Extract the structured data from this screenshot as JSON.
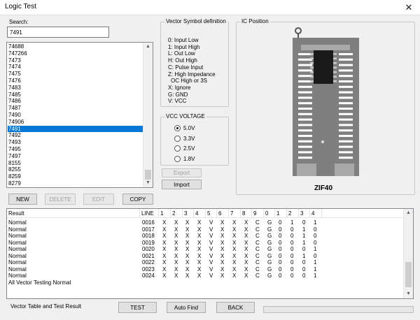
{
  "window": {
    "title": "Logic Test",
    "close_glyph": "✕"
  },
  "search": {
    "label": "Search:",
    "value": "7491"
  },
  "chip_list": {
    "items": [
      "74688",
      "747266",
      "7473",
      "7474",
      "7475",
      "7476",
      "7483",
      "7485",
      "7486",
      "7487",
      "7490",
      "74906",
      "7491",
      "7492",
      "7493",
      "7495",
      "7497",
      "8155",
      "8255",
      "8259",
      "8279"
    ],
    "selected": "7491"
  },
  "buttons": {
    "new": "NEW",
    "delete": "DELETE",
    "edit": "EDIT",
    "copy": "COPY",
    "export": "Export",
    "import": "Import",
    "test": "TEST",
    "auto_find": "Auto Find",
    "back": "BACK"
  },
  "vector_definition": {
    "title": "Vector Symbol definition",
    "lines": [
      "0: Input Low",
      "1: Input High",
      "L: Out Low",
      "H: Out High",
      "C: Pulse Input",
      "Z: High Impedance",
      "OC High or 3S",
      "X: Ignore",
      "G: GND",
      "V: VCC"
    ]
  },
  "vcc_voltage": {
    "title": "VCC VOLTAGE",
    "options": [
      "5.0V",
      "3.3V",
      "2.5V",
      "1.8V"
    ],
    "selected": "5.0V"
  },
  "ic_position": {
    "title": "IC Position",
    "socket_label": "ZIF40"
  },
  "result_table": {
    "headers": [
      "Result",
      "LINE",
      "1",
      "2",
      "3",
      "4",
      "5",
      "6",
      "7",
      "8",
      "9",
      "0",
      "1",
      "2",
      "3",
      "4"
    ],
    "rows": [
      [
        "Normal",
        "0016",
        "X",
        "X",
        "X",
        "X",
        "V",
        "X",
        "X",
        "X",
        "C",
        "G",
        "0",
        "1",
        "0",
        "1"
      ],
      [
        "Normal",
        "0017",
        "X",
        "X",
        "X",
        "X",
        "V",
        "X",
        "X",
        "X",
        "C",
        "G",
        "0",
        "0",
        "1",
        "0"
      ],
      [
        "Normal",
        "0018",
        "X",
        "X",
        "X",
        "X",
        "V",
        "X",
        "X",
        "X",
        "C",
        "G",
        "0",
        "0",
        "1",
        "0"
      ],
      [
        "Normal",
        "0019",
        "X",
        "X",
        "X",
        "X",
        "V",
        "X",
        "X",
        "X",
        "C",
        "G",
        "0",
        "0",
        "1",
        "0"
      ],
      [
        "Normal",
        "0020",
        "X",
        "X",
        "X",
        "X",
        "V",
        "X",
        "X",
        "X",
        "C",
        "G",
        "0",
        "0",
        "0",
        "1"
      ],
      [
        "Normal",
        "0021",
        "X",
        "X",
        "X",
        "X",
        "V",
        "X",
        "X",
        "X",
        "C",
        "G",
        "0",
        "0",
        "1",
        "0"
      ],
      [
        "Normal",
        "0022",
        "X",
        "X",
        "X",
        "X",
        "V",
        "X",
        "X",
        "X",
        "C",
        "G",
        "0",
        "0",
        "0",
        "1"
      ],
      [
        "Normal",
        "0023",
        "X",
        "X",
        "X",
        "X",
        "V",
        "X",
        "X",
        "X",
        "C",
        "G",
        "0",
        "0",
        "0",
        "1"
      ],
      [
        "Normal",
        "0024",
        "X",
        "X",
        "X",
        "X",
        "V",
        "X",
        "X",
        "X",
        "C",
        "G",
        "0",
        "0",
        "0",
        "1"
      ]
    ],
    "summary": "All Vector Testing Normal"
  },
  "footer": {
    "label": "Vector Table and Test Result"
  },
  "colors": {
    "selection": "#0078d7",
    "window_bg": "#f0f0f0",
    "socket_dark": "#7f7f7f",
    "chip_black": "#1a1a1a"
  }
}
